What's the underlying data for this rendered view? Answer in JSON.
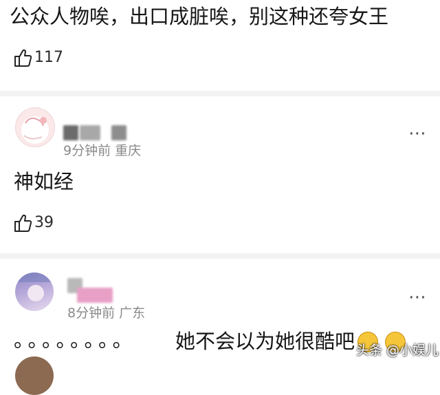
{
  "comments": [
    {
      "text": "公众人物唉，出口成脏唉，别这种还夸女王",
      "likes": "117"
    },
    {
      "meta": "9分钟前 重庆",
      "text": "神如经",
      "likes": "39",
      "more": "⋯"
    },
    {
      "meta": "8分钟前 广东",
      "dots": "。。。。。。。。",
      "text": "她不会以为她很酷吧",
      "more": "⋯"
    }
  ],
  "watermark": "头条 @小娱儿",
  "colors": {
    "text": "#161616",
    "meta": "#8a8a8a",
    "divider": "#f3f3f3"
  }
}
